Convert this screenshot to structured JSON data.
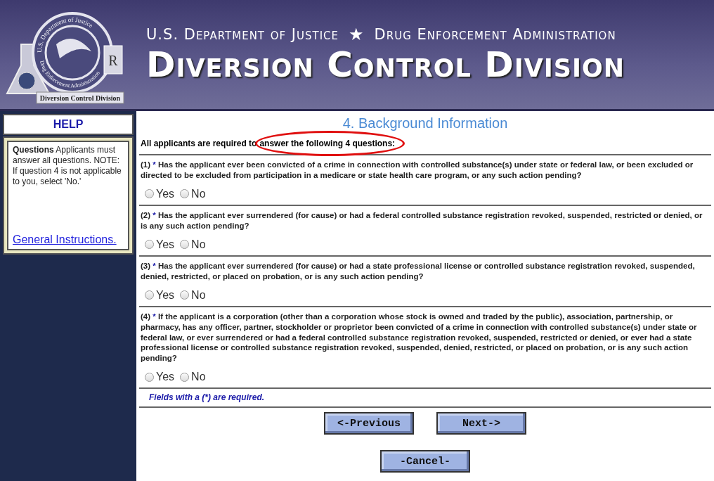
{
  "header": {
    "logo": {
      "ring_top": "U.S. Department of Justice",
      "ring_bottom": "Drug Enforcement Administration",
      "symbol": "R",
      "banner": "Diversion Control Division"
    },
    "agency_left": "U.S. Department of Justice",
    "star": "★",
    "agency_right": "Drug Enforcement Administration",
    "title": "Diversion Control Division"
  },
  "help": {
    "title": "HELP",
    "lead": "Questions",
    "text": "Applicants must answer all questions. NOTE: If question 4 is not applicable to you, select 'No.'",
    "link": "General Instructions."
  },
  "form": {
    "title": "4. Background Information",
    "intro_before": "All applicants are required to",
    "intro_after": "answer the following 4 questions:",
    "highlighted": true,
    "questions": [
      {
        "number": "(1)",
        "required_mark": "*",
        "text": "Has the applicant ever been convicted of a crime in connection with controlled substance(s) under state or federal law, or been excluded or directed to be excluded from participation in a medicare or state health care program, or any such action pending?",
        "options": [
          {
            "label": "Yes",
            "checked": false
          },
          {
            "label": "No",
            "checked": false
          }
        ]
      },
      {
        "number": "(2)",
        "required_mark": "*",
        "text": "Has the applicant ever surrendered (for cause) or had a federal controlled substance registration revoked, suspended, restricted or denied, or is any such action pending?",
        "options": [
          {
            "label": "Yes",
            "checked": false
          },
          {
            "label": "No",
            "checked": false
          }
        ]
      },
      {
        "number": "(3)",
        "required_mark": "*",
        "text": "Has the applicant ever surrendered (for cause) or had a state professional license or controlled substance registration revoked, suspended, denied, restricted, or placed on probation, or is any such action pending?",
        "options": [
          {
            "label": "Yes",
            "checked": false
          },
          {
            "label": "No",
            "checked": false
          }
        ]
      },
      {
        "number": "(4)",
        "required_mark": "*",
        "text": "If the applicant is a corporation (other than a corporation whose stock is owned and traded by the public), association, partnership, or pharmacy, has any officer, partner, stockholder or proprietor been convicted of a crime in connection with controlled substance(s) under state or federal law, or ever surrendered or had a federal controlled substance registration revoked, suspended, restricted or denied, or ever had a state professional license or controlled substance registration revoked, suspended, denied, restricted, or placed on probation, or is any such action pending?",
        "options": [
          {
            "label": "Yes",
            "checked": false
          },
          {
            "label": "No",
            "checked": false
          }
        ]
      }
    ],
    "required_note": "Fields with a (*) are required.",
    "buttons": [
      "<-Previous",
      "Next->"
    ],
    "cancel": "-Cancel-"
  }
}
